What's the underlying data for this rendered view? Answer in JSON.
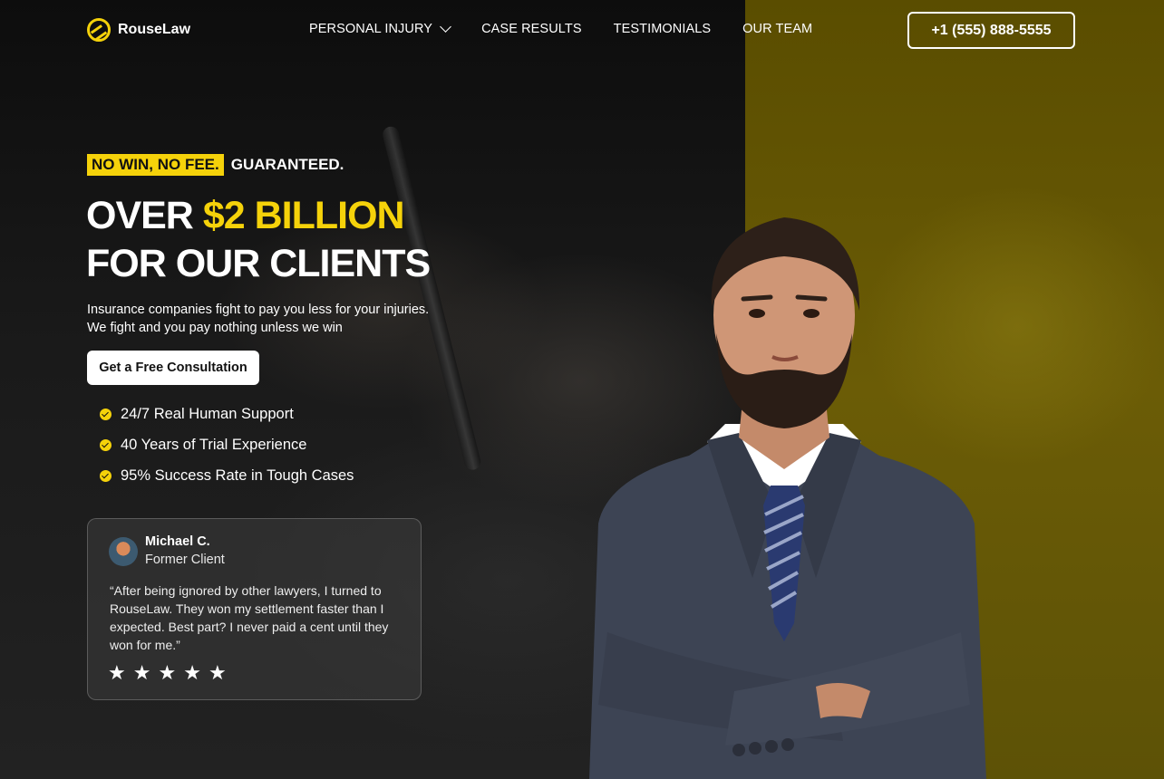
{
  "brand": {
    "name": "RouseLaw",
    "accent_color": "#f5d20a"
  },
  "nav": {
    "links": [
      {
        "label": "PERSONAL INJURY"
      },
      {
        "label": "CASE RESULTS"
      },
      {
        "label": "TESTIMONIALS"
      },
      {
        "label": "OUR TEAM"
      }
    ],
    "phone": "+1 (555) 888-5555"
  },
  "hero": {
    "tag_highlight": "NO WIN, NO FEE.",
    "tag_rest": "GUARANTEED.",
    "headline_part1": "OVER",
    "headline_accent": "$2 BILLION",
    "headline_line2": "FOR OUR CLIENTS",
    "subcopy": "Insurance companies fight to pay you less for your injuries. We fight and you pay nothing unless we win",
    "cta_label": "Get a Free Consultation",
    "features": [
      "24/7 Real Human Support",
      "40 Years of Trial Experience",
      "95% Success Rate in Tough Cases"
    ]
  },
  "testimonial": {
    "name": "Michael C.",
    "role": "Former Client",
    "quote": "“After being ignored by other lawyers, I turned to RouseLaw. They won my settlement faster than I expected. Best part? I never paid a cent until they won for me.”",
    "rating": 5
  }
}
